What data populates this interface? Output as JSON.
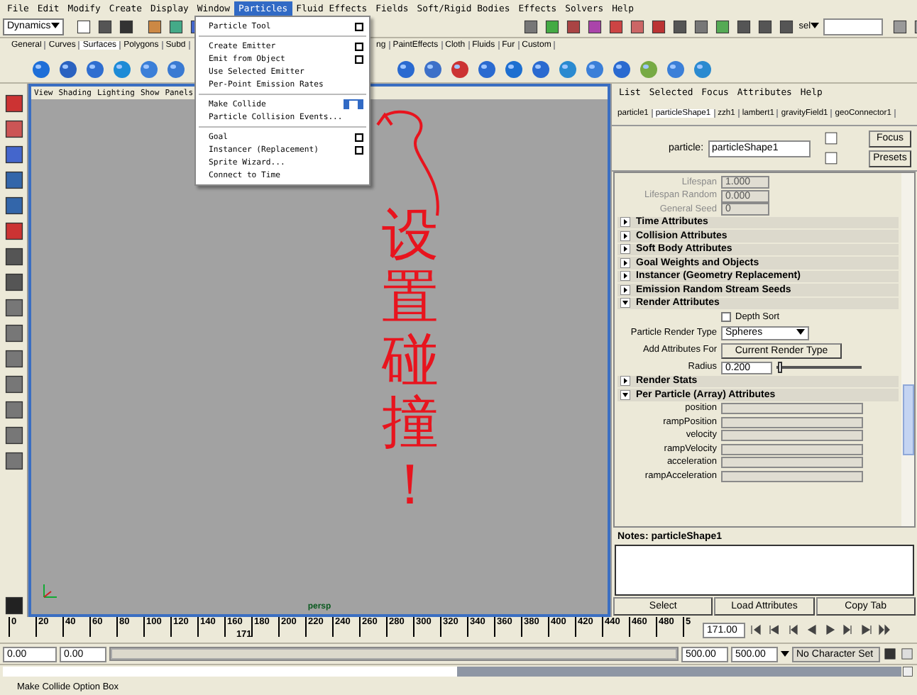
{
  "menu_bar": [
    {
      "label": "File",
      "selected": false
    },
    {
      "label": "Edit",
      "selected": false
    },
    {
      "label": "Modify",
      "selected": false
    },
    {
      "label": "Create",
      "selected": false
    },
    {
      "label": "Display",
      "selected": false
    },
    {
      "label": "Window",
      "selected": false
    },
    {
      "label": "Particles",
      "selected": true
    },
    {
      "label": "Fluid Effects",
      "selected": false
    },
    {
      "label": "Fields",
      "selected": false
    },
    {
      "label": "Soft/Rigid Bodies",
      "selected": false
    },
    {
      "label": "Effects",
      "selected": false
    },
    {
      "label": "Solvers",
      "selected": false
    },
    {
      "label": "Help",
      "selected": false
    }
  ],
  "status_line": {
    "mode": "Dynamics",
    "selection_label": "sel"
  },
  "shelf": {
    "tabs_left": [
      {
        "label": "General",
        "selected": false
      },
      {
        "label": "Curves",
        "selected": false
      },
      {
        "label": "Surfaces",
        "selected": true
      },
      {
        "label": "Polygons",
        "selected": false
      },
      {
        "label": "Subd",
        "selected": false
      }
    ],
    "tabs_right": [
      {
        "label": "ng",
        "selected": false
      },
      {
        "label": "PaintEffects",
        "selected": false
      },
      {
        "label": "Cloth",
        "selected": false
      },
      {
        "label": "Fluids",
        "selected": false
      },
      {
        "label": "Fur",
        "selected": false
      },
      {
        "label": "Custom",
        "selected": false
      }
    ]
  },
  "particles_menu": {
    "sections": [
      [
        {
          "label": "Particle Tool",
          "option_box": true,
          "option_hovered": false
        }
      ],
      [
        {
          "label": "Create Emitter",
          "option_box": true,
          "option_hovered": false
        },
        {
          "label": "Emit from Object",
          "option_box": true,
          "option_hovered": false
        },
        {
          "label": "Use Selected Emitter",
          "option_box": false
        },
        {
          "label": "Per-Point Emission Rates",
          "option_box": false
        }
      ],
      [
        {
          "label": "Make Collide",
          "option_box": true,
          "option_hovered": true
        },
        {
          "label": "Particle Collision Events...",
          "option_box": false
        }
      ],
      [
        {
          "label": "Goal",
          "option_box": true,
          "option_hovered": false
        },
        {
          "label": "Instancer (Replacement)",
          "option_box": true,
          "option_hovered": false
        },
        {
          "label": "Sprite Wizard...",
          "option_box": false
        },
        {
          "label": "Connect to Time",
          "option_box": false
        }
      ]
    ]
  },
  "viewport": {
    "menus": [
      "View",
      "Shading",
      "Lighting",
      "Show",
      "Panels"
    ],
    "camera_label": "persp",
    "annotation": {
      "text": "设置碰撞！",
      "color": "#e8141e"
    }
  },
  "attribute_editor": {
    "menus": [
      "List",
      "Selected",
      "Focus",
      "Attributes",
      "Help"
    ],
    "tabs": [
      {
        "label": "particle1",
        "selected": false
      },
      {
        "label": "particleShape1",
        "selected": true
      },
      {
        "label": "zzh1",
        "selected": false
      },
      {
        "label": "lambert1",
        "selected": false
      },
      {
        "label": "gravityField1",
        "selected": false
      },
      {
        "label": "geoConnector1",
        "selected": false
      }
    ],
    "node_label": "particle:",
    "node_value": "particleShape1",
    "buttons": [
      "Focus",
      "Presets"
    ],
    "dim_fields": [
      {
        "label": "Lifespan",
        "value": "1.000",
        "disabled": true
      },
      {
        "label": "Lifespan Random",
        "value": "0.000",
        "disabled": true
      },
      {
        "label": "General Seed",
        "value": "0",
        "disabled": true
      }
    ],
    "sections": [
      {
        "title": "Time Attributes",
        "expanded": false
      },
      {
        "title": "Collision Attributes",
        "expanded": false
      },
      {
        "title": "Soft Body Attributes",
        "expanded": false
      },
      {
        "title": "Goal Weights and Objects",
        "expanded": false
      },
      {
        "title": "Instancer (Geometry Replacement)",
        "expanded": false
      },
      {
        "title": "Emission Random Stream Seeds",
        "expanded": false
      },
      {
        "title": "Render Attributes",
        "expanded": true,
        "rows": [
          {
            "kind": "checkbox",
            "label": "Depth Sort",
            "checked": false
          },
          {
            "kind": "dropdown",
            "label": "Particle Render Type",
            "value": "Spheres"
          },
          {
            "kind": "button",
            "label": "Add Attributes For",
            "value": "Current Render Type"
          },
          {
            "kind": "slider",
            "label": "Radius",
            "value": "0.200",
            "level": 0.02
          }
        ]
      },
      {
        "title": "Render Stats",
        "expanded": false
      },
      {
        "title": "Per Particle (Array) Attributes",
        "expanded": true,
        "rows": [
          {
            "kind": "field",
            "label": "position"
          },
          {
            "kind": "field",
            "label": "rampPosition"
          },
          {
            "kind": "field",
            "label": "velocity"
          },
          {
            "kind": "field",
            "label": "rampVelocity"
          },
          {
            "kind": "field",
            "label": "acceleration"
          },
          {
            "kind": "field",
            "label": "rampAcceleration"
          }
        ]
      }
    ],
    "notes_title": "Notes: particleShape1",
    "bottom_buttons": [
      "Select",
      "Load Attributes",
      "Copy Tab"
    ]
  },
  "time_slider": {
    "ticks": [
      "0",
      "20",
      "40",
      "60",
      "80",
      "100",
      "120",
      "140",
      "160",
      "180",
      "200",
      "220",
      "240",
      "260",
      "280",
      "300",
      "320",
      "340",
      "360",
      "380",
      "400",
      "420",
      "440",
      "460",
      "480",
      "5"
    ],
    "current_frame": "171",
    "level": 0.342,
    "time_field": "171.00"
  },
  "range_slider": {
    "start_time": "0.00",
    "range_start": "0.00",
    "level": 1,
    "range_end": "500.00",
    "end_time": "500.00",
    "character_set": "No Character Set"
  },
  "help_line": "Make Collide Option Box"
}
